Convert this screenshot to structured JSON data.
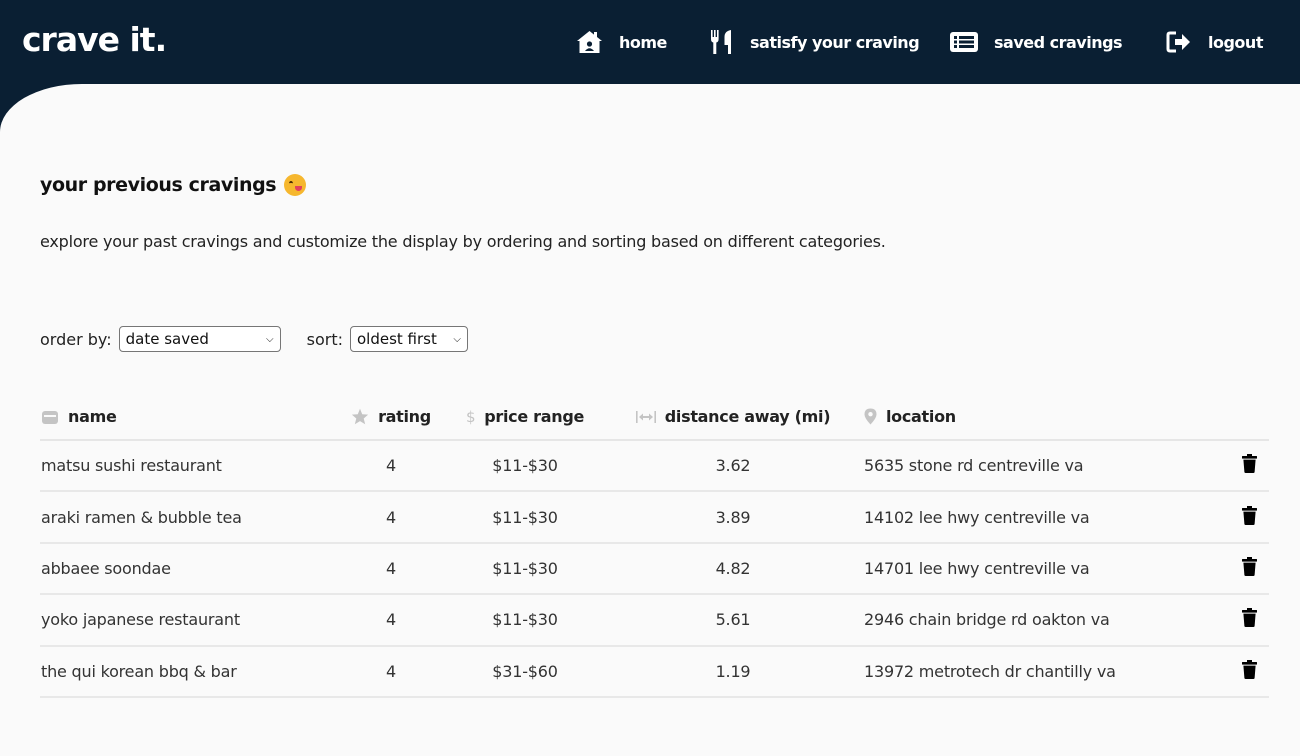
{
  "app": {
    "brand": "crave it."
  },
  "nav": {
    "home": "home",
    "satisfy": "satisfy your craving",
    "saved": "saved cravings",
    "logout": "logout"
  },
  "page": {
    "title": "your previous cravings",
    "description": "explore your past cravings and customize the display by ordering and sorting based on different categories."
  },
  "controls": {
    "order_label": "order by:",
    "order_value": "date saved",
    "sort_label": "sort:",
    "sort_value": "oldest first"
  },
  "table": {
    "headers": {
      "name": "name",
      "rating": "rating",
      "price": "price range",
      "distance": "distance away (mi)",
      "location": "location"
    },
    "rows": [
      {
        "name": "matsu sushi restaurant",
        "rating": "4",
        "price": "$11-$30",
        "distance": "3.62",
        "location": "5635 stone rd centreville va"
      },
      {
        "name": "araki ramen & bubble tea",
        "rating": "4",
        "price": "$11-$30",
        "distance": "3.89",
        "location": "14102 lee hwy centreville va"
      },
      {
        "name": "abbaee soondae",
        "rating": "4",
        "price": "$11-$30",
        "distance": "4.82",
        "location": "14701 lee hwy centreville va"
      },
      {
        "name": "yoko japanese restaurant",
        "rating": "4",
        "price": "$11-$30",
        "distance": "5.61",
        "location": "2946 chain bridge rd oakton va"
      },
      {
        "name": "the qui korean bbq & bar",
        "rating": "4",
        "price": "$31-$60",
        "distance": "1.19",
        "location": "13972 metrotech dr chantilly va"
      }
    ]
  },
  "icons": {
    "home": "home-icon",
    "satisfy": "utensils-icon",
    "saved": "list-icon",
    "logout": "logout-icon",
    "name": "store-icon",
    "rating": "star-icon",
    "price": "dollar-icon",
    "distance": "distance-arrows-icon",
    "location": "map-pin-icon",
    "delete": "trash-icon",
    "emoji": "yum-face-emoji"
  },
  "colors": {
    "navbar": "#0a1f33",
    "content_bg": "#fafafa",
    "header_icon": "#c4c4c4"
  }
}
